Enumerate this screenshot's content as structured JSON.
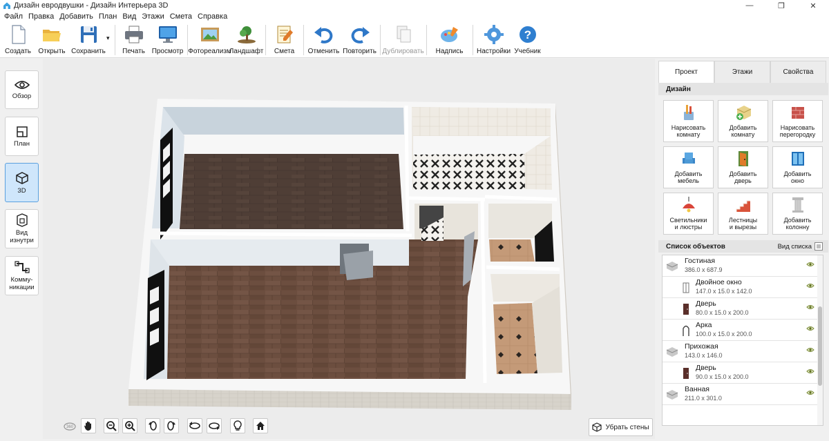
{
  "window": {
    "title": "Дизайн евродвушки - Дизайн Интерьера 3D",
    "controls": {
      "minimize": "—",
      "maximize": "❐",
      "close": "✕"
    }
  },
  "menu": [
    "Файл",
    "Правка",
    "Добавить",
    "План",
    "Вид",
    "Этажи",
    "Смета",
    "Справка"
  ],
  "toolbar": {
    "create": "Создать",
    "open": "Открыть",
    "save": "Сохранить",
    "print": "Печать",
    "preview": "Просмотр",
    "photoreal": "Фотореализм",
    "landscape": "Ландшафт",
    "estimate": "Смета",
    "undo": "Отменить",
    "redo": "Повторить",
    "duplicate": "Дублировать",
    "label": "Надпись",
    "settings": "Настройки",
    "tutorial": "Учебник",
    "dropdown_glyph": "▾"
  },
  "sidebar": {
    "overview": "Обзор",
    "plan": "План",
    "view3d": "3D",
    "inside_line1": "Вид",
    "inside_line2": "изнутри",
    "comm_line1": "Комму-",
    "comm_line2": "никации",
    "active": "3D"
  },
  "viewport": {
    "remove_walls": "Убрать стены",
    "control_icons": [
      "rotate-360-icon",
      "hand-pan-icon",
      "zoom-out-icon",
      "zoom-in-icon",
      "rotate-left-icon",
      "rotate-right-icon",
      "tilt-up-icon",
      "tilt-down-icon",
      "light-bulb-icon",
      "home-icon"
    ]
  },
  "right_panel": {
    "tabs": [
      "Проект",
      "Этажи",
      "Свойства"
    ],
    "active_tab": "Проект",
    "design_header": "Дизайн",
    "design_buttons": [
      {
        "l1": "Нарисовать",
        "l2": "комнату",
        "icon": "draw-room-icon"
      },
      {
        "l1": "Добавить",
        "l2": "комнату",
        "icon": "add-room-icon"
      },
      {
        "l1": "Нарисовать",
        "l2": "перегородку",
        "icon": "draw-partition-icon"
      },
      {
        "l1": "Добавить",
        "l2": "мебель",
        "icon": "armchair-icon"
      },
      {
        "l1": "Добавить",
        "l2": "дверь",
        "icon": "door-icon"
      },
      {
        "l1": "Добавить",
        "l2": "окно",
        "icon": "window-icon"
      },
      {
        "l1": "Светильники",
        "l2": "и люстры",
        "icon": "lamp-icon"
      },
      {
        "l1": "Лестницы",
        "l2": "и вырезы",
        "icon": "stairs-icon"
      },
      {
        "l1": "Добавить",
        "l2": "колонну",
        "icon": "column-icon"
      }
    ],
    "objects_header": "Список объектов",
    "list_view": "Вид списка",
    "objects": [
      {
        "name": "Гостиная",
        "dims": "386.0 x 687.9",
        "type": "room",
        "level": 0
      },
      {
        "name": "Двойное окно",
        "dims": "147.0 x 15.0 x 142.0",
        "type": "window",
        "level": 1
      },
      {
        "name": "Дверь",
        "dims": "80.0 x 15.0 x 200.0",
        "type": "door",
        "level": 1
      },
      {
        "name": "Арка",
        "dims": "100.0 x 15.0 x 200.0",
        "type": "arch",
        "level": 1
      },
      {
        "name": "Прихожая",
        "dims": "143.0 x 146.0",
        "type": "room",
        "level": 0
      },
      {
        "name": "Дверь",
        "dims": "90.0 x 15.0 x 200.0",
        "type": "door",
        "level": 1
      },
      {
        "name": "Ванная",
        "dims": "211.0 x 301.0",
        "type": "room",
        "level": 0
      }
    ]
  },
  "colors": {
    "accent": "#3d8fd8",
    "floor_wood": "#6a4c3d",
    "floor_dark": "#4e3d35",
    "wall_top": "#f7f7f7",
    "wall_outer": "#d9d4cc"
  }
}
